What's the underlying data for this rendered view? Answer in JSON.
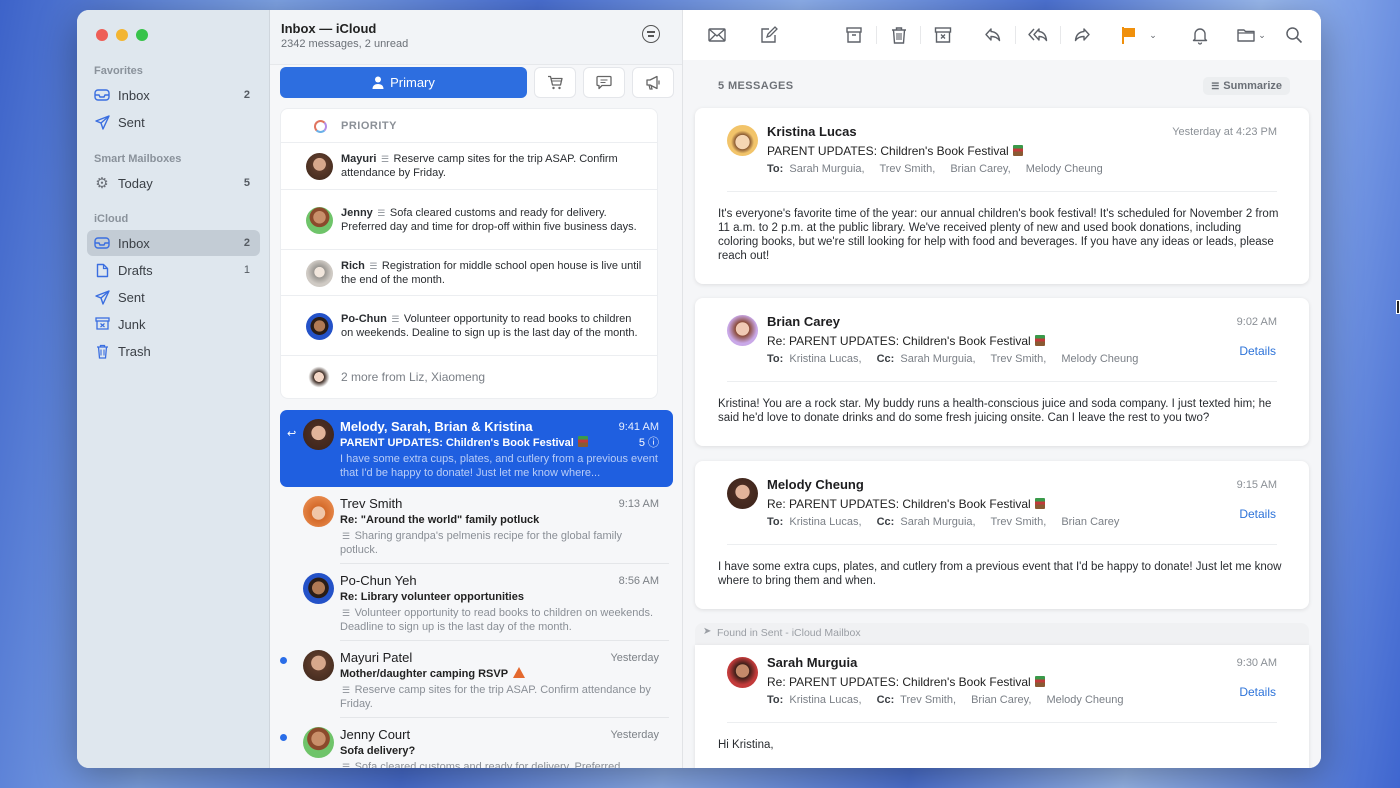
{
  "window": {
    "traffic_lights": [
      "close",
      "minimize",
      "zoom"
    ]
  },
  "sidebar": {
    "sections": [
      {
        "title": "Favorites",
        "items": [
          {
            "label": "Inbox",
            "icon": "tray-icon",
            "count": "2"
          },
          {
            "label": "Sent",
            "icon": "paperplane-icon",
            "count": ""
          }
        ]
      },
      {
        "title": "Smart Mailboxes",
        "items": [
          {
            "label": "Today",
            "icon": "gear-icon",
            "count": "5"
          }
        ]
      },
      {
        "title": "iCloud",
        "items": [
          {
            "label": "Inbox",
            "icon": "tray-icon",
            "count": "2",
            "selected": true
          },
          {
            "label": "Drafts",
            "icon": "document-icon",
            "count": "1"
          },
          {
            "label": "Sent",
            "icon": "paperplane-icon",
            "count": ""
          },
          {
            "label": "Junk",
            "icon": "junk-icon",
            "count": ""
          },
          {
            "label": "Trash",
            "icon": "trash-icon",
            "count": ""
          }
        ]
      }
    ]
  },
  "list": {
    "title": "Inbox — iCloud",
    "subtitle": "2342 messages, 2 unread",
    "categories": {
      "primary": "Primary",
      "others": [
        "shopping-cart-icon",
        "chat-bubble-icon",
        "megaphone-icon"
      ]
    },
    "priority": {
      "header": "PRIORITY",
      "items": [
        {
          "name": "Mayuri",
          "text": "Reserve camp sites for the trip ASAP. Confirm attendance by Friday."
        },
        {
          "name": "Jenny",
          "text": "Sofa cleared customs and ready for delivery. Preferred day and time for drop-off within five business days."
        },
        {
          "name": "Rich",
          "text": "Registration for middle school open house is live until the end of the month."
        },
        {
          "name": "Po-Chun",
          "text": "Volunteer opportunity to read books to children on weekends. Dealine to sign up is the last day of the month."
        }
      ],
      "more": "2 more from Liz, Xiaomeng"
    },
    "messages": [
      {
        "sender": "Melody, Sarah, Brian & Kristina",
        "time": "9:41 AM",
        "subject": "PARENT UPDATES: Children's Book Festival",
        "preview": "I have some extra cups, plates, and cutlery from a previous event that I'd be happy to donate! Just let me know where...",
        "count": "5",
        "selected": true,
        "replied": true
      },
      {
        "sender": "Trev Smith",
        "time": "9:13 AM",
        "subject": "Re: \"Around the world\" family potluck",
        "preview": "Sharing grandpa's pelmenis recipe for the global family potluck."
      },
      {
        "sender": "Po-Chun Yeh",
        "time": "8:56 AM",
        "subject": "Re: Library volunteer opportunities",
        "preview": "Volunteer opportunity to read books to children on weekends. Deadline to sign up is the last day of the month."
      },
      {
        "sender": "Mayuri Patel",
        "time": "Yesterday",
        "subject": "Mother/daughter camping RSVP",
        "preview": "Reserve camp sites for the trip ASAP. Confirm attendance by Friday.",
        "unread": true
      },
      {
        "sender": "Jenny Court",
        "time": "Yesterday",
        "subject": "Sofa delivery?",
        "preview": "Sofa cleared customs and ready for delivery. Preferred...",
        "unread": true
      }
    ]
  },
  "toolbar": {
    "buttons": [
      "get-mail",
      "compose",
      "archive",
      "delete",
      "junk",
      "reply",
      "reply-all",
      "forward",
      "flag",
      "flag-menu",
      "notify",
      "move-to",
      "search"
    ],
    "flag_color": "#f0900c"
  },
  "reader": {
    "message_count_label": "5 MESSAGES",
    "summarize_label": "Summarize",
    "details_label": "Details",
    "to_label": "To:",
    "cc_label": "Cc:",
    "found_in_label": "Found in Sent - iCloud Mailbox",
    "cards": [
      {
        "name": "Kristina Lucas",
        "time": "Yesterday at 4:23 PM",
        "subject": "PARENT UPDATES: Children's Book Festival",
        "to": [
          "Sarah Murguia,",
          "Trev Smith,",
          "Brian Carey,",
          "Melody Cheung"
        ],
        "cc": [],
        "body": "It's everyone's favorite time of the year: our annual children's book festival! It's scheduled for November 2 from 11 a.m. to 2 p.m. at the public library. We've received plenty of new and used book donations, including coloring books, but we're still looking for help with food and beverages. If you have any ideas or leads, please reach out!"
      },
      {
        "name": "Brian Carey",
        "time": "9:02 AM",
        "subject": "Re: PARENT UPDATES: Children's Book Festival",
        "to": [
          "Kristina Lucas,"
        ],
        "cc": [
          "Sarah Murguia,",
          "Trev Smith,",
          "Melody Cheung"
        ],
        "body": "Kristina! You are a rock star. My buddy runs a health-conscious juice and soda company. I just texted him; he said he'd love to donate drinks and do some fresh juicing onsite. Can I leave the rest to you two?"
      },
      {
        "name": "Melody Cheung",
        "time": "9:15 AM",
        "subject": "Re: PARENT UPDATES: Children's Book Festival",
        "to": [
          "Kristina Lucas,"
        ],
        "cc": [
          "Sarah Murguia,",
          "Trev Smith,",
          "Brian Carey"
        ],
        "body": "I have some extra cups, plates, and cutlery from a previous event that I'd be happy to donate! Just let me know where to bring them and when."
      },
      {
        "name": "Sarah Murguia",
        "time": "9:30 AM",
        "subject": "Re: PARENT UPDATES: Children's Book Festival",
        "to": [
          "Kristina Lucas,"
        ],
        "cc": [
          "Trev Smith,",
          "Brian Carey,",
          "Melody Cheung"
        ],
        "body": "Hi Kristina,"
      }
    ]
  }
}
